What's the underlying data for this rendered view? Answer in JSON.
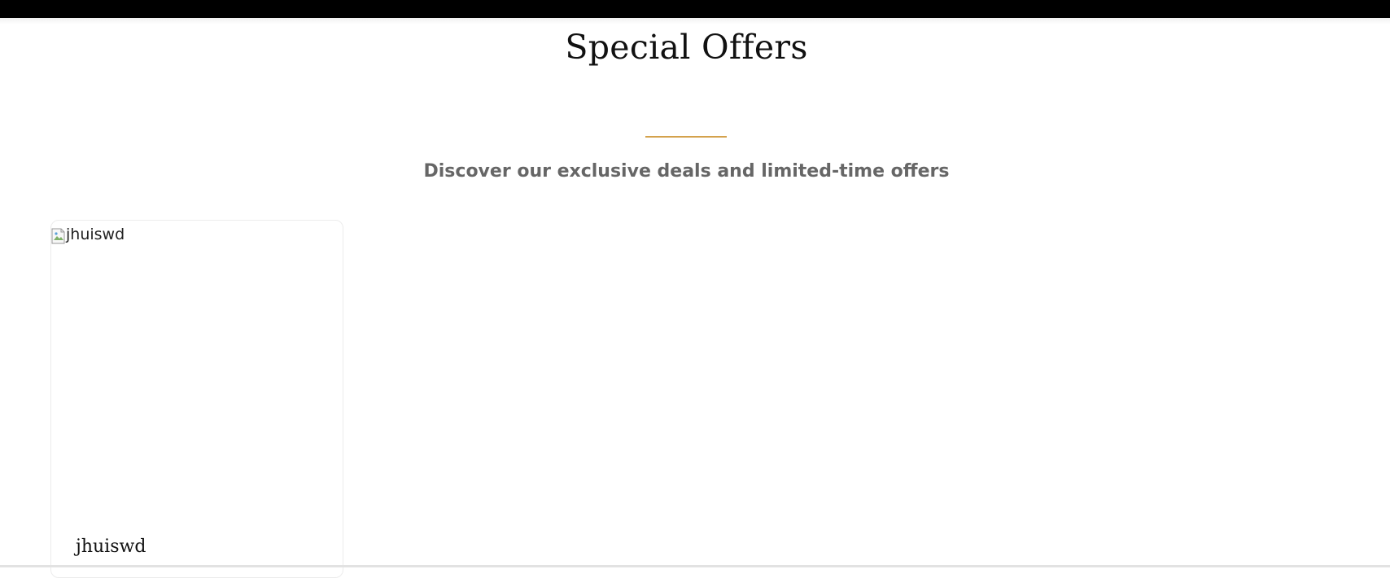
{
  "header": {
    "title": "Special Offers",
    "subtitle": "Discover our exclusive deals and limited-time offers"
  },
  "colors": {
    "accent": "#d4a24c",
    "subtitle": "#666666",
    "top_bar": "#000000"
  },
  "offers": [
    {
      "image_alt": "jhuiswd",
      "title": "jhuiswd"
    }
  ],
  "icons": {
    "broken_image": "broken-image-icon"
  }
}
